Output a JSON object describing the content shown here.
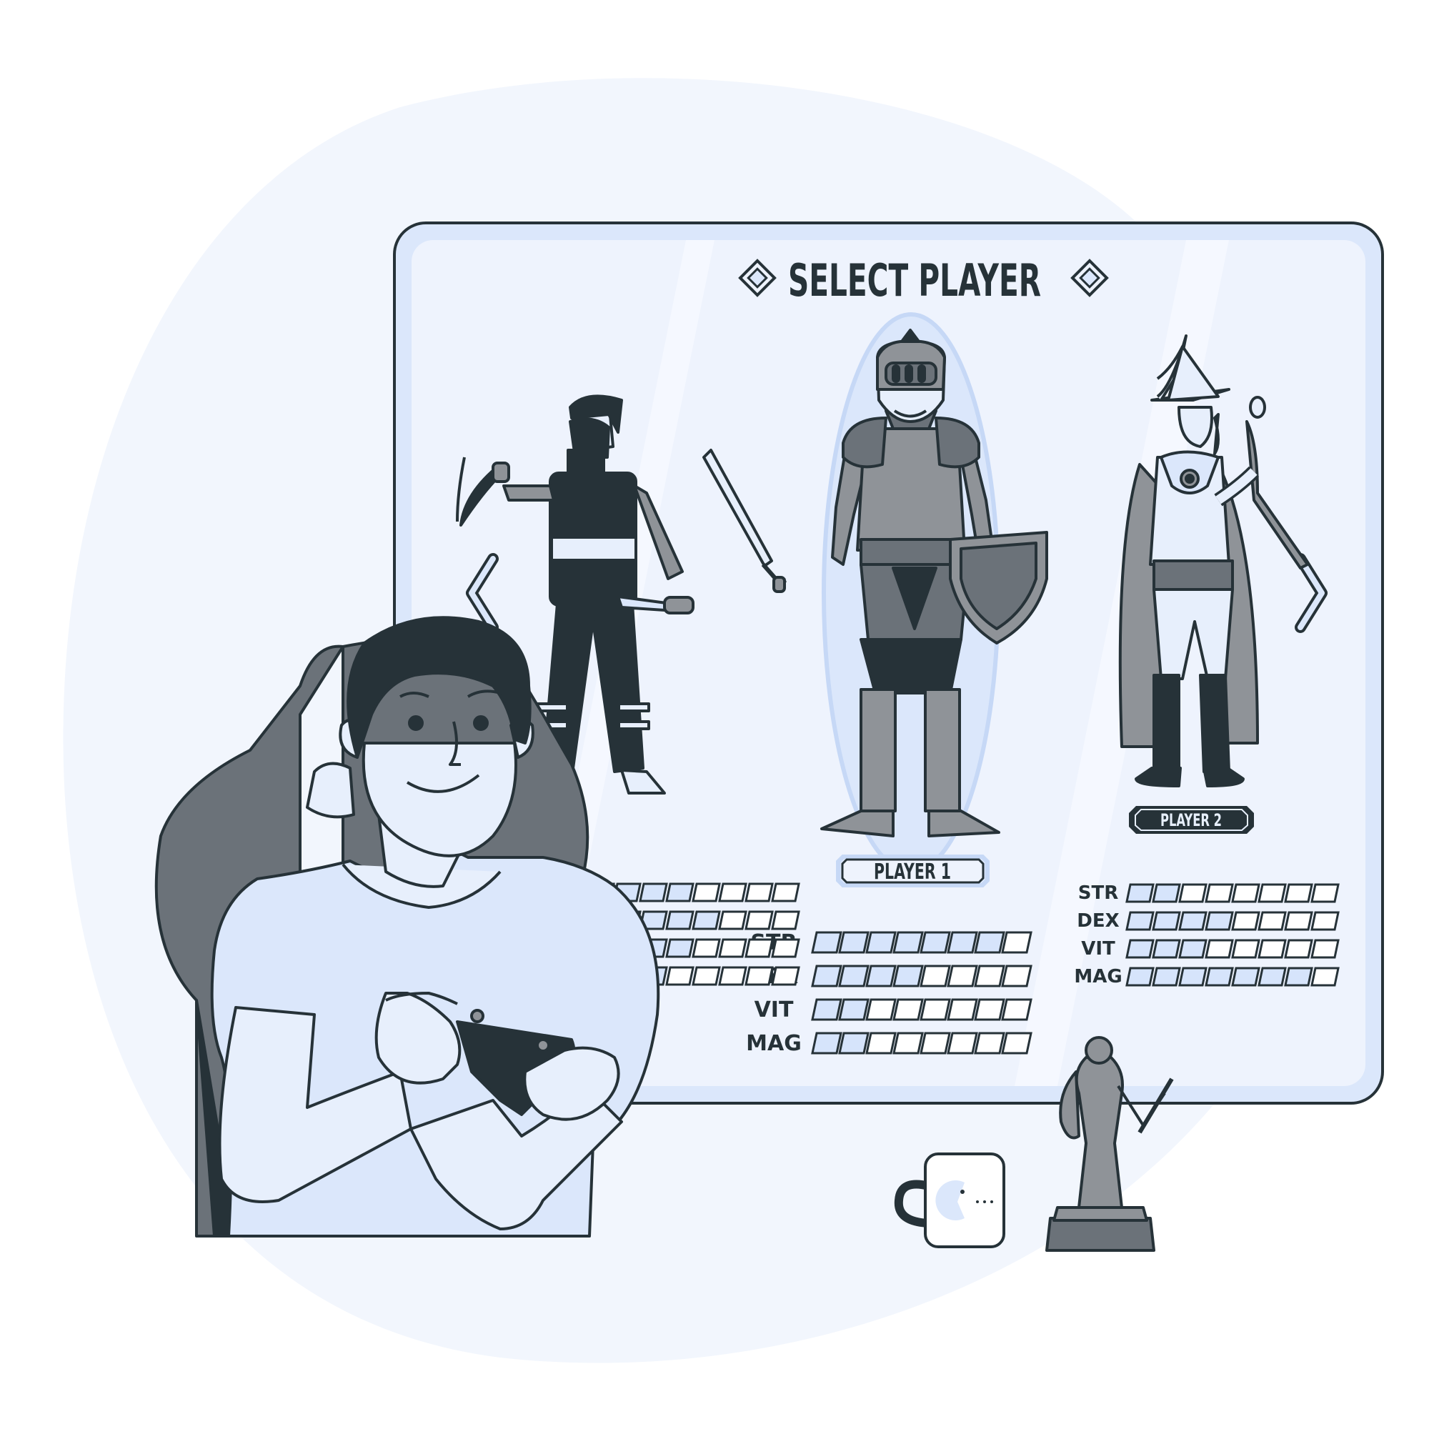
{
  "screen": {
    "title": "SELECT PLAYER",
    "nav": {
      "prev_icon": "chevron-left-icon",
      "next_icon": "chevron-right-icon"
    }
  },
  "characters": [
    {
      "id": "rogue",
      "label": "",
      "selected": false,
      "icon": "rogue-character-icon"
    },
    {
      "id": "knight",
      "label": "PLAYER 1",
      "selected": true,
      "icon": "knight-character-icon"
    },
    {
      "id": "wizard",
      "label": "PLAYER 2",
      "selected": false,
      "icon": "wizard-character-icon"
    }
  ],
  "stats": {
    "slots": 8,
    "knight": [
      {
        "name": "STR",
        "value": 7
      },
      {
        "name": "DEX",
        "value": 4
      },
      {
        "name": "VIT",
        "value": 2
      },
      {
        "name": "MAG",
        "value": 2
      }
    ],
    "wizard": [
      {
        "name": "STR",
        "value": 2
      },
      {
        "name": "DEX",
        "value": 4
      },
      {
        "name": "VIT",
        "value": 3
      },
      {
        "name": "MAG",
        "value": 7
      }
    ],
    "rogue_visible": [
      4,
      5,
      4,
      3
    ]
  },
  "colors": {
    "outline": "#263238",
    "filled_slot": "#d6e4fb",
    "empty_slot": "#ffffff",
    "panel": "#eef3fd",
    "blob": "#f2f6fd",
    "dark_gray": "#6b7279",
    "mid_gray": "#8f9398",
    "shirt": "#dbe7fb"
  },
  "props": {
    "mug_icon": "pacman-mug-icon",
    "trophy_icon": "knight-trophy-icon",
    "controller_icon": "gamepad-icon"
  }
}
